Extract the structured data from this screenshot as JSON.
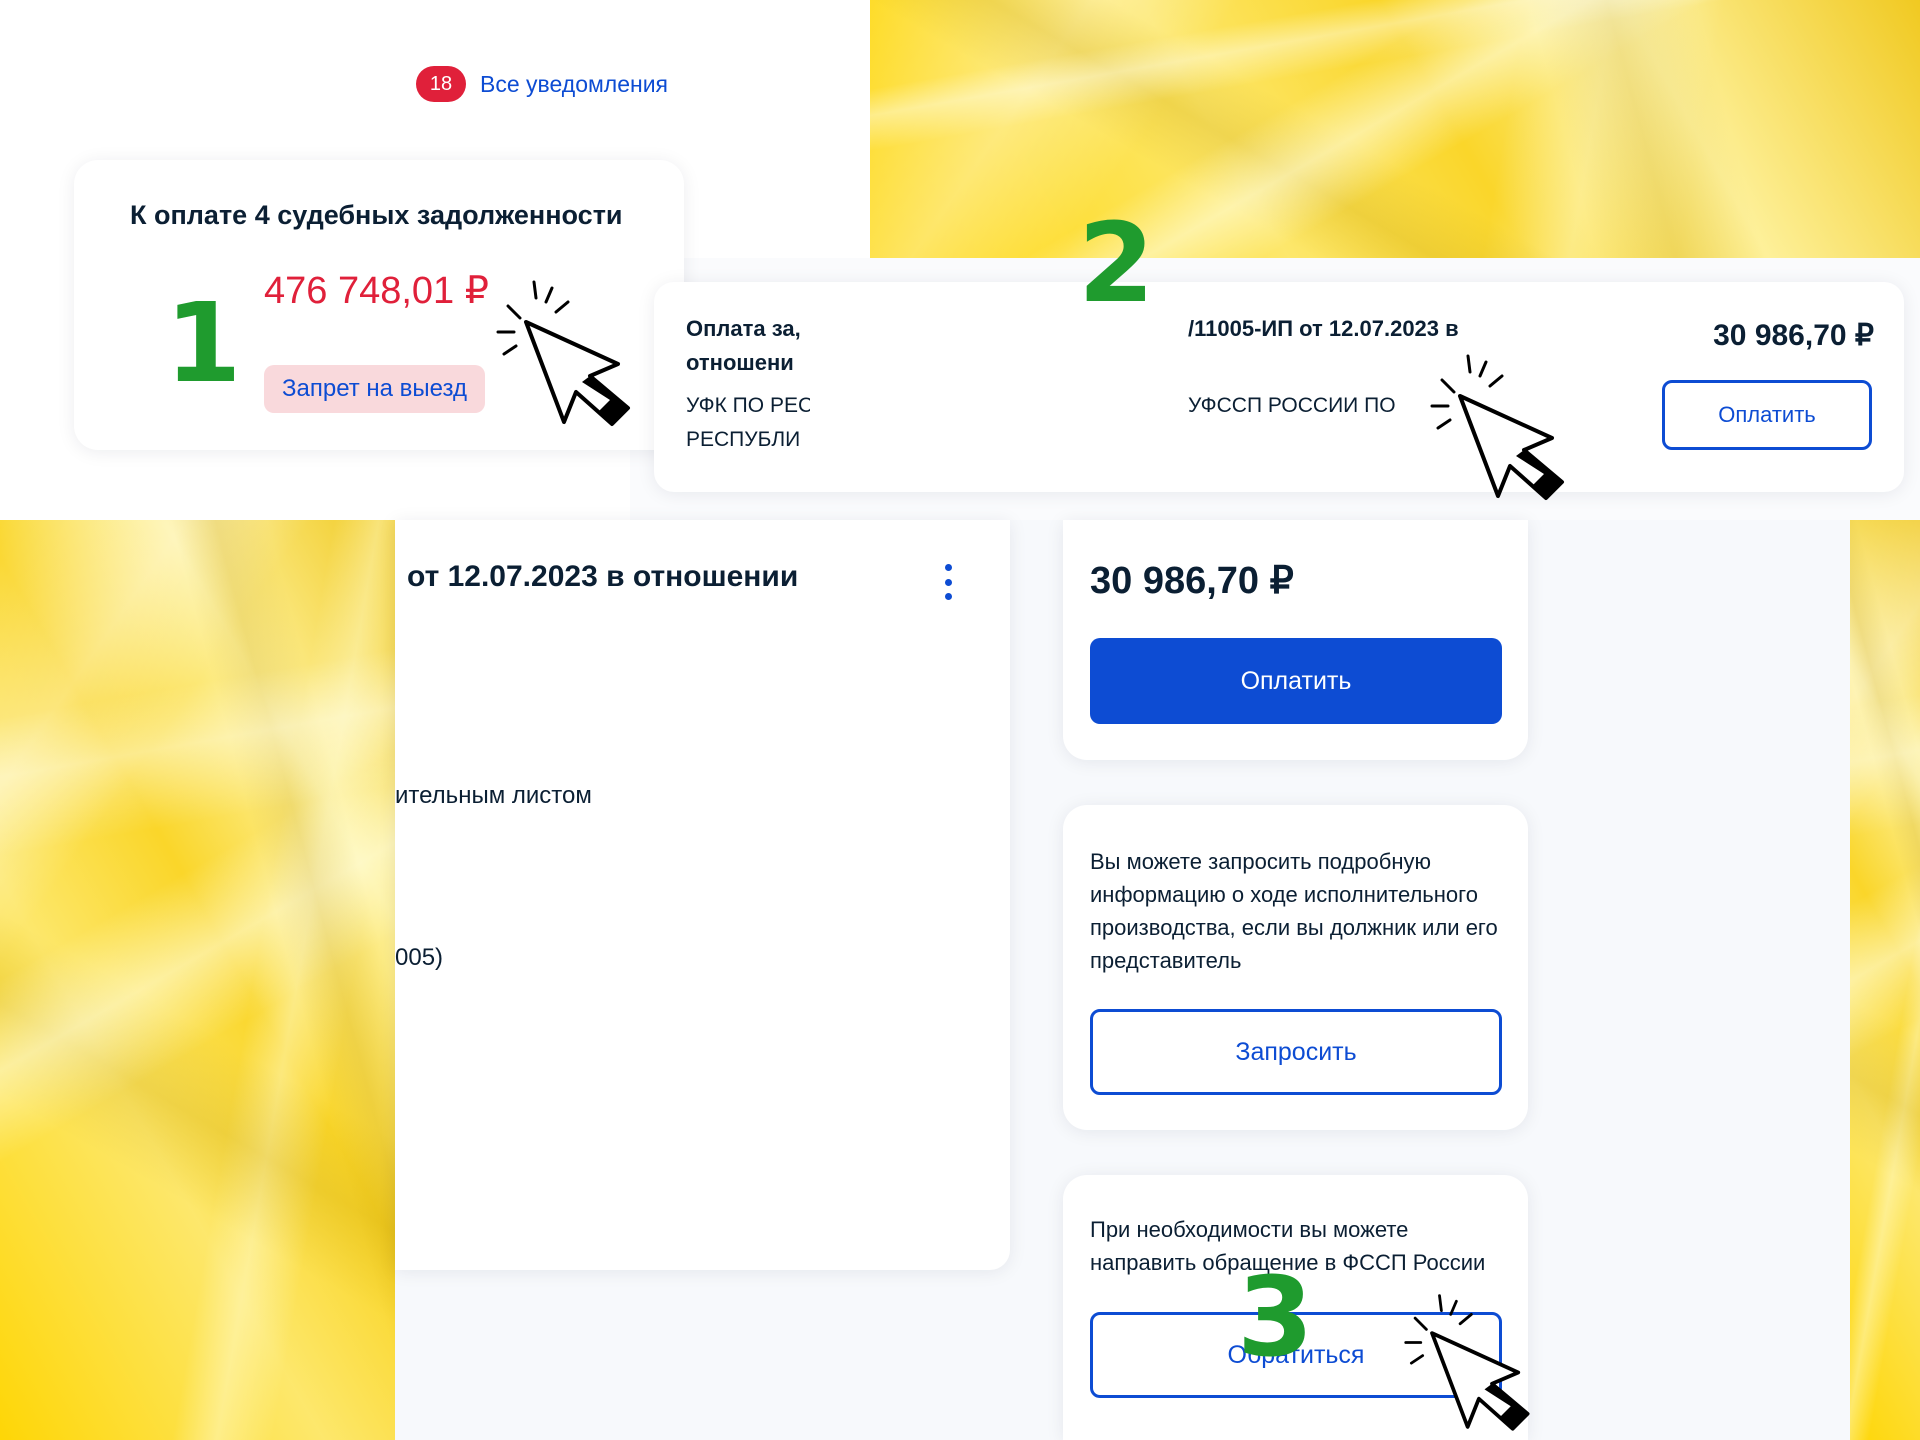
{
  "notifications": {
    "count": "18",
    "label": "Все уведомления"
  },
  "debt_card": {
    "title": "К оплате 4 судебных задолженности",
    "amount": "476 748,01 ₽",
    "badge": "Запрет на выезд"
  },
  "payment_row": {
    "title_part1": "Оплата за,",
    "title_part2": "/11005-ИП от 12.07.2023 в",
    "title_line2": "отношени",
    "sub_part1": "УФК ПО РЕС",
    "sub_part2": "УФССП РОССИИ ПО",
    "sub_line2": "РЕСПУБЛИ",
    "amount": "30 986,70 ₽",
    "pay_label": "Оплатить"
  },
  "detail": {
    "heading": "от 12.07.2023 в отношении",
    "line1": "ительным листом",
    "line2": "005)"
  },
  "pay_panel": {
    "amount": "30 986,70 ₽",
    "pay_label": "Оплатить"
  },
  "request_panel": {
    "text": "Вы можете запросить подробную информацию о ходе исполнительного производства, если вы должник или его представитель",
    "button": "Запросить"
  },
  "appeal_panel": {
    "text": "При необходимости вы можете направить обращение в ФССП России",
    "button": "Обратиться"
  },
  "steps": [
    "1",
    "2",
    "3"
  ],
  "colors": {
    "accent": "#0d4cd3",
    "debt_red": "#e0203a",
    "step_green": "#1f9b2e",
    "badge_bg": "#f9d9dc"
  }
}
